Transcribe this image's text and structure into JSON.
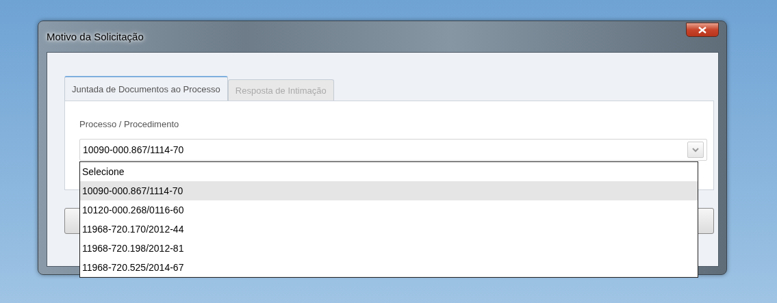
{
  "window": {
    "title": "Motivo da Solicitação"
  },
  "tabs": [
    {
      "label": "Juntada de Documentos ao Processo",
      "selected": true
    },
    {
      "label": "Resposta de Intimação",
      "selected": false
    }
  ],
  "field": {
    "label": "Processo / Procedimento",
    "value": "10090-000.867/1114-70",
    "expanded": true
  },
  "options": [
    {
      "label": "Selecione",
      "selected": false
    },
    {
      "label": "10090-000.867/1114-70",
      "selected": true
    },
    {
      "label": "10120-000.268/0116-60",
      "selected": false
    },
    {
      "label": "11968-720.170/2012-44",
      "selected": false
    },
    {
      "label": "11968-720.198/2012-81",
      "selected": false
    },
    {
      "label": "11968-720.525/2014-67",
      "selected": false
    }
  ]
}
